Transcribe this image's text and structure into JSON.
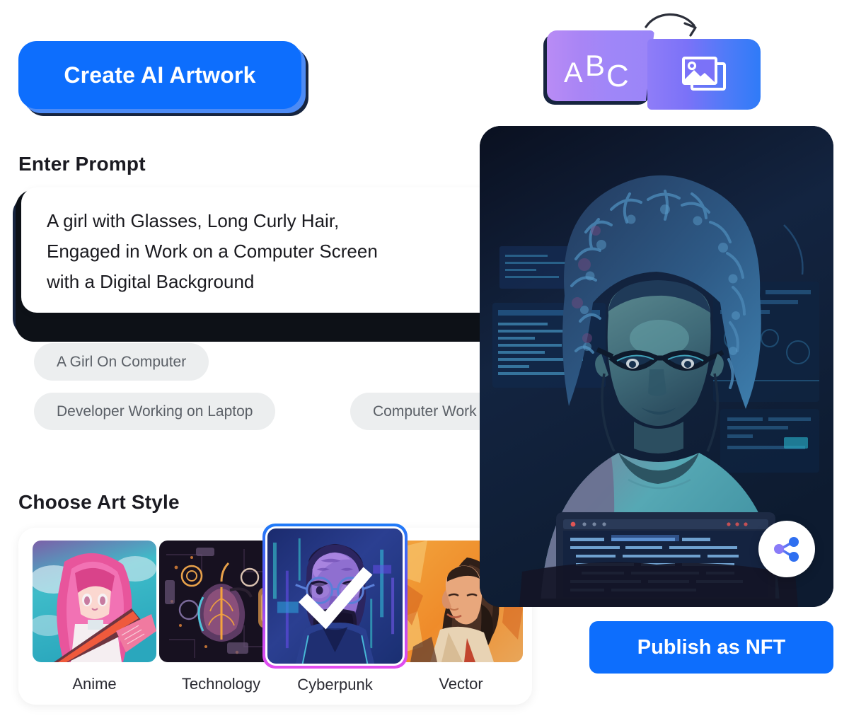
{
  "cta": {
    "label": "Create AI Artwork"
  },
  "mode_toggle": {
    "text_mode_label": "ABC",
    "text_mode_icon": "abc-text-icon",
    "image_mode_icon": "image-stack-icon",
    "arrow_icon": "curved-arrow-icon",
    "left_gradient_from": "#b98cf5",
    "left_gradient_to": "#9a85f8",
    "right_gradient_from": "#8f7df8",
    "right_gradient_to": "#2f7bf8"
  },
  "prompt": {
    "heading": "Enter Prompt",
    "value": "A girl with Glasses, Long Curly Hair,\nEngaged in Work on a Computer Screen\nwith a Digital Background",
    "placeholder": "Enter Prompt",
    "clear_icon": "close-circle-icon"
  },
  "suggestions": [
    {
      "label": "A Girl On Computer"
    },
    {
      "label": "Developer Working on Laptop"
    },
    {
      "label": "Computer Work"
    }
  ],
  "art_style": {
    "heading": "Choose Art Style",
    "selected": "Cyberpunk",
    "options": [
      {
        "label": "Anime",
        "selected": false
      },
      {
        "label": "Technology",
        "selected": false
      },
      {
        "label": "Cyberpunk",
        "selected": true
      },
      {
        "label": "Vector",
        "selected": false
      }
    ],
    "selected_check_icon": "checkmark-icon",
    "selected_border_from": "#1f7bf8",
    "selected_border_to": "#e24df0"
  },
  "preview": {
    "share_icon": "share-icon",
    "alt": "AI generated artwork of a girl with glasses and curly hair at a computer"
  },
  "publish": {
    "label": "Publish as NFT"
  },
  "colors": {
    "primary_blue": "#0d6efd",
    "dark_navy": "#16243f",
    "chip_bg": "#eceeef",
    "text_dark": "#1b1b22"
  }
}
